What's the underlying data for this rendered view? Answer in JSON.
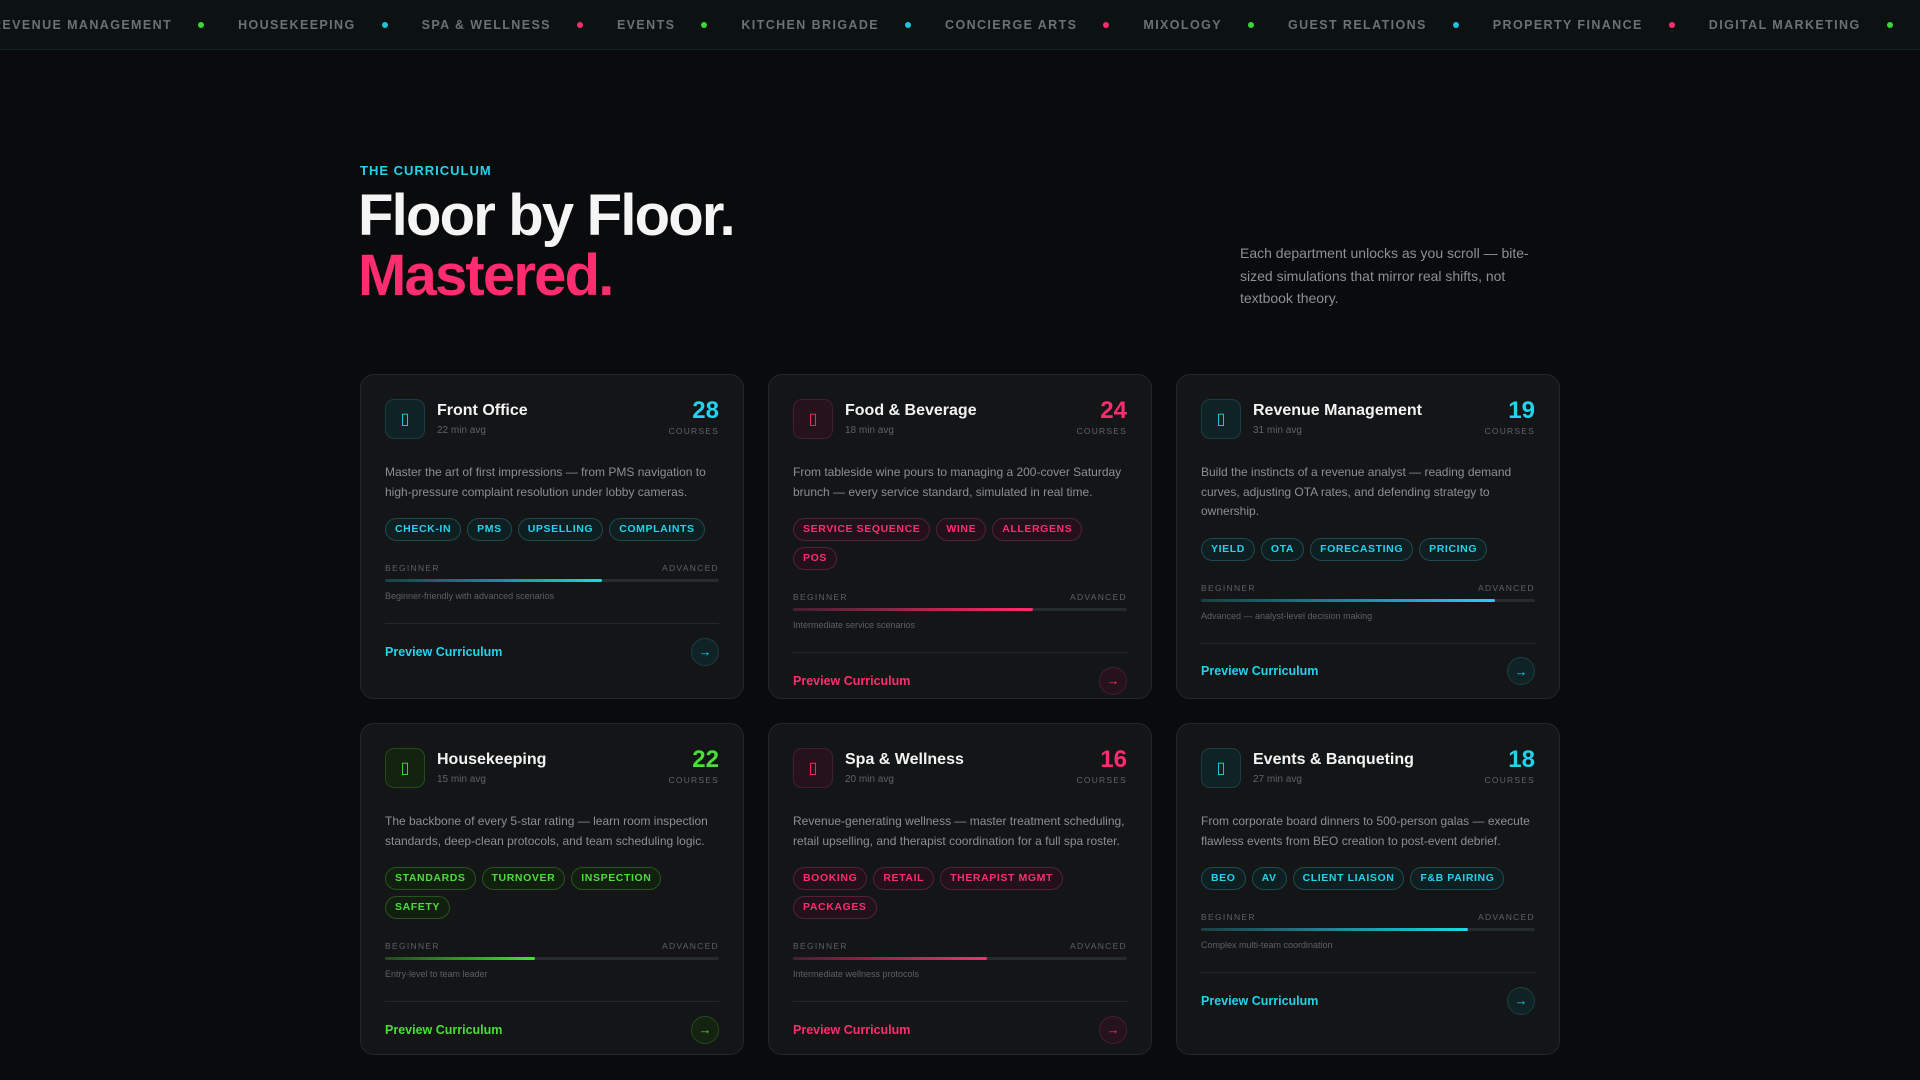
{
  "ticker": [
    {
      "label": "Revenue Management",
      "dot": "#3ad63a"
    },
    {
      "label": "Housekeeping",
      "dot": "#1ec3e0"
    },
    {
      "label": "Spa & Wellness",
      "dot": "#ff2d6f"
    },
    {
      "label": "Events",
      "dot": "#3ad63a"
    },
    {
      "label": "Kitchen Brigade",
      "dot": "#1ec3e0"
    },
    {
      "label": "Concierge Arts",
      "dot": "#ff2d6f"
    },
    {
      "label": "Mixology",
      "dot": "#3ad63a"
    },
    {
      "label": "Guest Relations",
      "dot": "#1ec3e0"
    },
    {
      "label": "Property Finance",
      "dot": "#ff2d6f"
    },
    {
      "label": "Digital Marketing",
      "dot": "#3ad63a"
    }
  ],
  "header": {
    "eyebrow": "THE CURRICULUM",
    "title_line1": "Floor by Floor.",
    "title_line2": "Mastered.",
    "lede": "Each department unlocks as you scroll — bite-sized simulations that mirror real shifts, not textbook theory."
  },
  "colors": {
    "cyan": "#22d3ee",
    "pink": "#ff2d6f",
    "green": "#4ade3a"
  },
  "cards": [
    {
      "title": "Front Office",
      "sub": "22 min avg",
      "count": "28",
      "count_label": "COURSES",
      "accent": "cyan",
      "icon": "door-icon",
      "desc": "Master the art of first impressions — from PMS navigation to high-pressure complaint resolution under lobby cameras.",
      "tags": [
        "CHECK-IN",
        "PMS",
        "UPSELLING",
        "COMPLAINTS"
      ],
      "level_min": "BEGINNER",
      "level_max": "ADVANCED",
      "level": 0.65,
      "level_note": "Beginner-friendly with advanced scenarios",
      "cta": "Preview Curriculum"
    },
    {
      "title": "Food & Beverage",
      "sub": "18 min avg",
      "count": "24",
      "count_label": "COURSES",
      "accent": "pink",
      "icon": "utensils-icon",
      "desc": "From tableside wine pours to managing a 200-cover Saturday brunch — every service standard, simulated in real time.",
      "tags": [
        "SERVICE SEQUENCE",
        "WINE",
        "ALLERGENS",
        "POS"
      ],
      "level_min": "BEGINNER",
      "level_max": "ADVANCED",
      "level": 0.72,
      "level_note": "Intermediate service scenarios",
      "cta": "Preview Curriculum"
    },
    {
      "title": "Revenue Management",
      "sub": "31 min avg",
      "count": "19",
      "count_label": "COURSES",
      "accent": "cyan",
      "icon": "chart-icon",
      "desc": "Build the instincts of a revenue analyst — reading demand curves, adjusting OTA rates, and defending strategy to ownership.",
      "tags": [
        "YIELD",
        "OTA",
        "FORECASTING",
        "PRICING"
      ],
      "level_min": "BEGINNER",
      "level_max": "ADVANCED",
      "level": 0.88,
      "level_note": "Advanced — analyst-level decision making",
      "cta": "Preview Curriculum"
    },
    {
      "title": "Housekeeping",
      "sub": "15 min avg",
      "count": "22",
      "count_label": "COURSES",
      "accent": "green",
      "icon": "broom-icon",
      "desc": "The backbone of every 5-star rating — learn room inspection standards, deep-clean protocols, and team scheduling logic.",
      "tags": [
        "STANDARDS",
        "TURNOVER",
        "INSPECTION",
        "SAFETY"
      ],
      "level_min": "BEGINNER",
      "level_max": "ADVANCED",
      "level": 0.45,
      "level_note": "Entry-level to team leader",
      "cta": "Preview Curriculum"
    },
    {
      "title": "Spa & Wellness",
      "sub": "20 min avg",
      "count": "16",
      "count_label": "COURSES",
      "accent": "pink",
      "icon": "lotus-icon",
      "desc": "Revenue-generating wellness — master treatment scheduling, retail upselling, and therapist coordination for a full spa roster.",
      "tags": [
        "BOOKING",
        "RETAIL",
        "THERAPIST MGMT",
        "PACKAGES"
      ],
      "level_min": "BEGINNER",
      "level_max": "ADVANCED",
      "level": 0.58,
      "level_note": "Intermediate wellness protocols",
      "cta": "Preview Curriculum"
    },
    {
      "title": "Events & Banqueting",
      "sub": "27 min avg",
      "count": "18",
      "count_label": "COURSES",
      "accent": "cyan",
      "icon": "calendar-icon",
      "desc": "From corporate board dinners to 500-person galas — execute flawless events from BEO creation to post-event debrief.",
      "tags": [
        "BEO",
        "AV",
        "CLIENT LIAISON",
        "F&B PAIRING"
      ],
      "level_min": "BEGINNER",
      "level_max": "ADVANCED",
      "level": 0.8,
      "level_note": "Complex multi-team coordination",
      "cta": "Preview Curriculum"
    }
  ]
}
